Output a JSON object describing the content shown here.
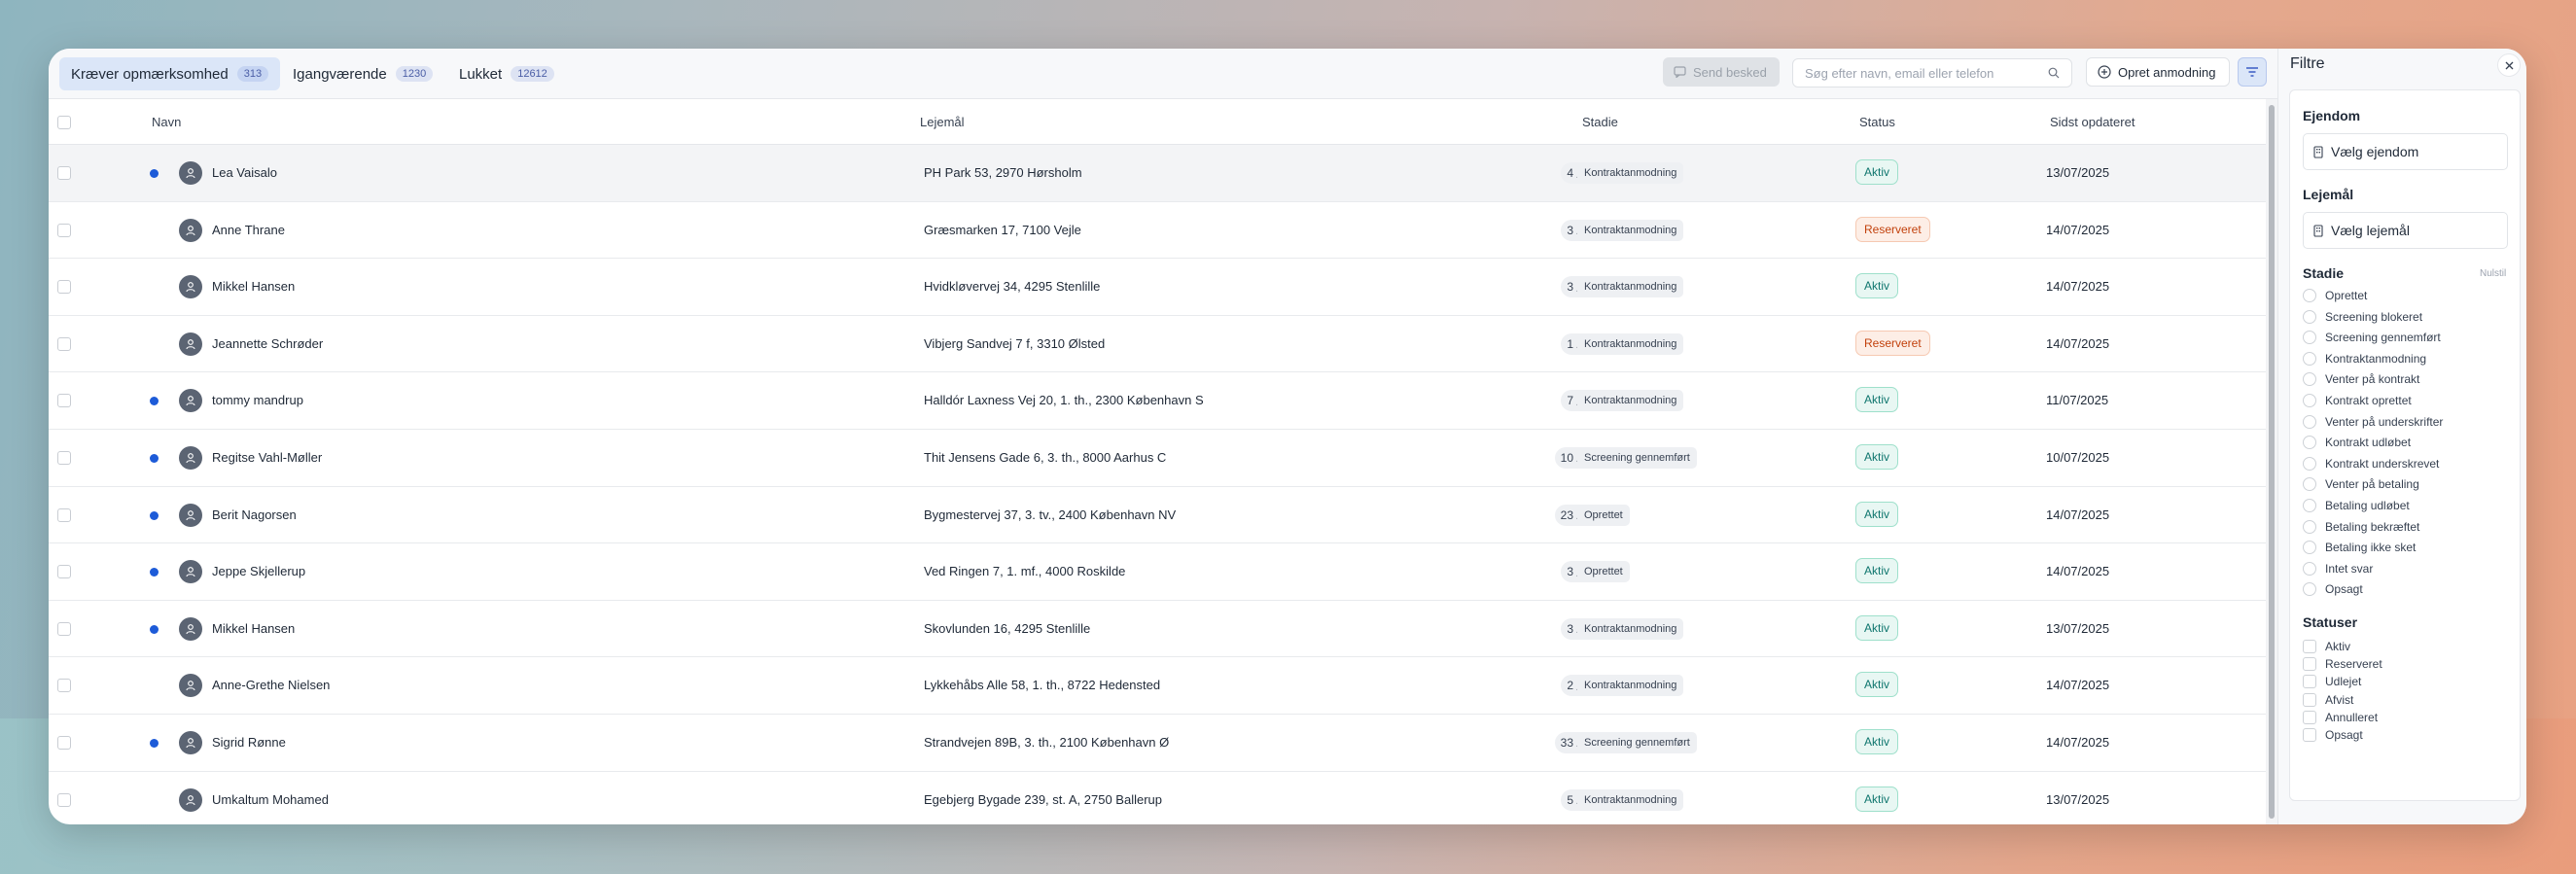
{
  "tabs": [
    {
      "label": "Kræver opmærksomhed",
      "count": "313"
    },
    {
      "label": "Igangværende",
      "count": "1230"
    },
    {
      "label": "Lukket",
      "count": "12612"
    }
  ],
  "toolbar": {
    "send_label": "Send besked",
    "search_placeholder": "Søg efter navn, email eller telefon",
    "create_label": "Opret anmodning"
  },
  "table": {
    "headers": {
      "name": "Navn",
      "lease": "Lejemål",
      "stage": "Stadie",
      "status": "Status",
      "updated": "Sidst opdateret"
    },
    "rows": [
      {
        "unread": true,
        "name": "Lea Vaisalo",
        "lease": "PH Park 53, 2970 Hørsholm",
        "count": "4",
        "stage": "Kontraktanmodning",
        "status": "Aktiv",
        "updated": "13/07/2025"
      },
      {
        "unread": false,
        "name": "Anne Thrane",
        "lease": "Græsmarken 17, 7100 Vejle",
        "count": "3",
        "stage": "Kontraktanmodning",
        "status": "Reserveret",
        "updated": "14/07/2025"
      },
      {
        "unread": false,
        "name": "Mikkel Hansen",
        "lease": "Hvidkløvervej 34, 4295 Stenlille",
        "count": "3",
        "stage": "Kontraktanmodning",
        "status": "Aktiv",
        "updated": "14/07/2025"
      },
      {
        "unread": false,
        "name": "Jeannette Schrøder",
        "lease": "Vibjerg Sandvej 7 f, 3310 Ølsted",
        "count": "1",
        "stage": "Kontraktanmodning",
        "status": "Reserveret",
        "updated": "14/07/2025"
      },
      {
        "unread": true,
        "name": "tommy mandrup",
        "lease": "Halldór Laxness Vej 20, 1. th., 2300 København S",
        "count": "7",
        "stage": "Kontraktanmodning",
        "status": "Aktiv",
        "updated": "11/07/2025"
      },
      {
        "unread": true,
        "name": "Regitse Vahl-Møller",
        "lease": "Thit Jensens Gade 6, 3. th., 8000 Aarhus C",
        "count": "10",
        "stage": "Screening gennemført",
        "status": "Aktiv",
        "updated": "10/07/2025"
      },
      {
        "unread": true,
        "name": "Berit Nagorsen",
        "lease": "Bygmestervej 37, 3. tv., 2400 København NV",
        "count": "23",
        "stage": "Oprettet",
        "status": "Aktiv",
        "updated": "14/07/2025"
      },
      {
        "unread": true,
        "name": "Jeppe Skjellerup",
        "lease": "Ved Ringen 7, 1. mf., 4000 Roskilde",
        "count": "3",
        "stage": "Oprettet",
        "status": "Aktiv",
        "updated": "14/07/2025"
      },
      {
        "unread": true,
        "name": "Mikkel Hansen",
        "lease": "Skovlunden 16, 4295 Stenlille",
        "count": "3",
        "stage": "Kontraktanmodning",
        "status": "Aktiv",
        "updated": "13/07/2025"
      },
      {
        "unread": false,
        "name": "Anne-Grethe Nielsen",
        "lease": "Lykkehåbs Alle 58, 1. th., 8722 Hedensted",
        "count": "2",
        "stage": "Kontraktanmodning",
        "status": "Aktiv",
        "updated": "14/07/2025"
      },
      {
        "unread": true,
        "name": "Sigrid Rønne",
        "lease": "Strandvejen 89B, 3. th., 2100 København Ø",
        "count": "33",
        "stage": "Screening gennemført",
        "status": "Aktiv",
        "updated": "14/07/2025"
      },
      {
        "unread": false,
        "name": "Umkaltum Mohamed",
        "lease": "Egebjerg Bygade 239, st. A, 2750 Ballerup",
        "count": "5",
        "stage": "Kontraktanmodning",
        "status": "Aktiv",
        "updated": "13/07/2025"
      }
    ]
  },
  "filters": {
    "title": "Filtre",
    "property": {
      "heading": "Ejendom",
      "placeholder": "Vælg ejendom"
    },
    "lease": {
      "heading": "Lejemål",
      "placeholder": "Vælg lejemål"
    },
    "stage": {
      "heading": "Stadie",
      "reset": "Nulstil",
      "options": [
        "Oprettet",
        "Screening blokeret",
        "Screening gennemført",
        "Kontraktanmodning",
        "Venter på kontrakt",
        "Kontrakt oprettet",
        "Venter på underskrifter",
        "Kontrakt udløbet",
        "Kontrakt underskrevet",
        "Venter på betaling",
        "Betaling udløbet",
        "Betaling bekræftet",
        "Betaling ikke sket",
        "Intet svar",
        "Opsagt"
      ]
    },
    "statuses": {
      "heading": "Statuser",
      "options": [
        "Aktiv",
        "Reserveret",
        "Udlejet",
        "Afvist",
        "Annulleret",
        "Opsagt"
      ]
    }
  },
  "colors": {
    "accent": "#1d5bd8",
    "active_tab": "#dbe6f8",
    "status_active": "#0f766e",
    "status_reserved": "#c2410c"
  }
}
